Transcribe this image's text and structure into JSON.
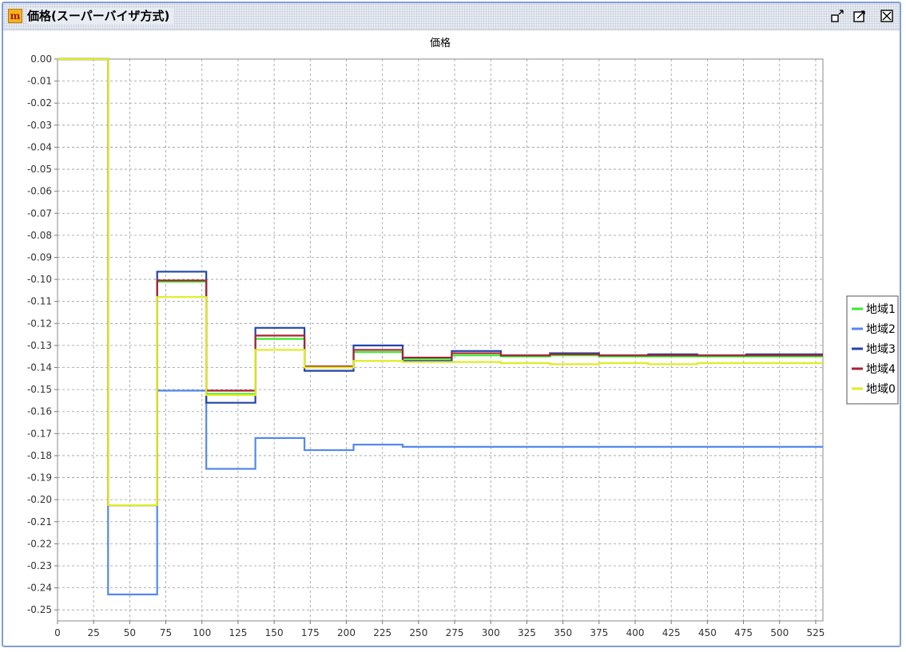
{
  "window": {
    "title": "価格(スーパーバイザ方式)",
    "app_icon": "m",
    "buttons": [
      "restore-icon",
      "maximize-icon",
      "close-icon"
    ]
  },
  "chart_data": {
    "type": "line",
    "title": "価格",
    "xlabel": "",
    "ylabel": "",
    "xlim": [
      0,
      530
    ],
    "ylim": [
      -0.255,
      0.0
    ],
    "x_ticks": [
      "0",
      "25",
      "50",
      "75",
      "100",
      "125",
      "150",
      "175",
      "200",
      "225",
      "250",
      "275",
      "300",
      "325",
      "350",
      "375",
      "400",
      "425",
      "450",
      "475",
      "500",
      "525"
    ],
    "y_ticks": [
      "0.00",
      "-0.01",
      "-0.02",
      "-0.03",
      "-0.04",
      "-0.05",
      "-0.06",
      "-0.07",
      "-0.08",
      "-0.09",
      "-0.10",
      "-0.11",
      "-0.12",
      "-0.13",
      "-0.14",
      "-0.15",
      "-0.16",
      "-0.17",
      "-0.18",
      "-0.19",
      "-0.20",
      "-0.21",
      "-0.22",
      "-0.23",
      "-0.24",
      "-0.25"
    ],
    "grid": true,
    "legend_position": "right",
    "series": [
      {
        "name": "地域1",
        "color": "#33ee22",
        "step_x": [
          0,
          35,
          69,
          103,
          137,
          171,
          205,
          239,
          273,
          307,
          341,
          375,
          409,
          443,
          477,
          530
        ],
        "values": [
          0.0,
          -0.2025,
          -0.101,
          -0.152,
          -0.127,
          -0.1395,
          -0.133,
          -0.136,
          -0.1345,
          -0.135,
          -0.1345,
          -0.135,
          -0.135,
          -0.135,
          -0.135,
          -0.135
        ]
      },
      {
        "name": "地域2",
        "color": "#5588ee",
        "step_x": [
          0,
          35,
          69,
          103,
          137,
          171,
          205,
          239,
          273,
          307,
          341,
          375,
          409,
          443,
          477,
          530
        ],
        "values": [
          0.0,
          -0.243,
          -0.1505,
          -0.186,
          -0.172,
          -0.1775,
          -0.175,
          -0.176,
          -0.176,
          -0.176,
          -0.176,
          -0.176,
          -0.176,
          -0.176,
          -0.176,
          -0.176
        ]
      },
      {
        "name": "地域3",
        "color": "#2244aa",
        "step_x": [
          0,
          35,
          69,
          103,
          137,
          171,
          205,
          239,
          273,
          307,
          341,
          375,
          409,
          443,
          477,
          530
        ],
        "values": [
          0.0,
          -0.2025,
          -0.0965,
          -0.156,
          -0.122,
          -0.1415,
          -0.13,
          -0.137,
          -0.1325,
          -0.1345,
          -0.1335,
          -0.1345,
          -0.134,
          -0.1345,
          -0.134,
          -0.134
        ]
      },
      {
        "name": "地域4",
        "color": "#aa2233",
        "step_x": [
          0,
          35,
          69,
          103,
          137,
          171,
          205,
          239,
          273,
          307,
          341,
          375,
          409,
          443,
          477,
          530
        ],
        "values": [
          0.0,
          -0.2025,
          -0.1005,
          -0.1505,
          -0.1255,
          -0.1395,
          -0.132,
          -0.1355,
          -0.1335,
          -0.1345,
          -0.134,
          -0.1345,
          -0.1345,
          -0.1345,
          -0.1345,
          -0.1345
        ]
      },
      {
        "name": "地域0",
        "color": "#ddee22",
        "step_x": [
          0,
          35,
          69,
          103,
          137,
          171,
          205,
          239,
          273,
          307,
          341,
          375,
          409,
          443,
          477,
          530
        ],
        "values": [
          0.0,
          -0.2025,
          -0.108,
          -0.1525,
          -0.132,
          -0.14,
          -0.137,
          -0.1375,
          -0.1375,
          -0.138,
          -0.1385,
          -0.138,
          -0.1385,
          -0.138,
          -0.138,
          -0.138
        ]
      }
    ]
  }
}
